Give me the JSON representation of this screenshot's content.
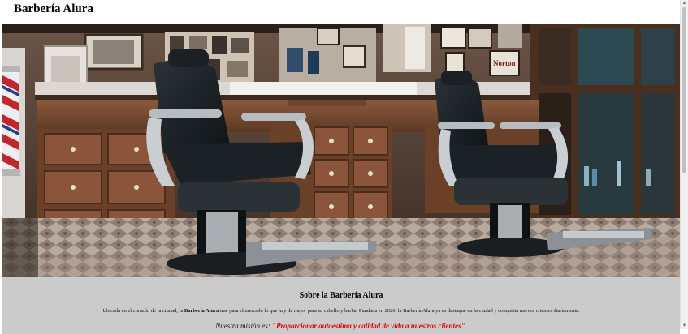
{
  "header": {
    "site_title": "Barbería Alura"
  },
  "hero": {
    "wall_sign": "Norton"
  },
  "about": {
    "title": "Sobre la Barbería Alura",
    "text_before": "Ubicada en el corazón de la ciudad, la ",
    "text_bold": "Barbería Alura",
    "text_after": " trae para el mercado lo que hay de mejor para su cabello y barba. Fundada en 2020, la Barbería Alura ya es destaque en la ciudad y conquista nuevos clientes diariamente.",
    "mission_prefix": "Nuestra misión es: ",
    "mission_quote": "\"Proporcionar autoestima y calidad de vida a nuestros clientes\"",
    "mission_suffix": "."
  },
  "colors": {
    "about_background": "#cbcbcb",
    "mission_accent": "#e00000"
  }
}
